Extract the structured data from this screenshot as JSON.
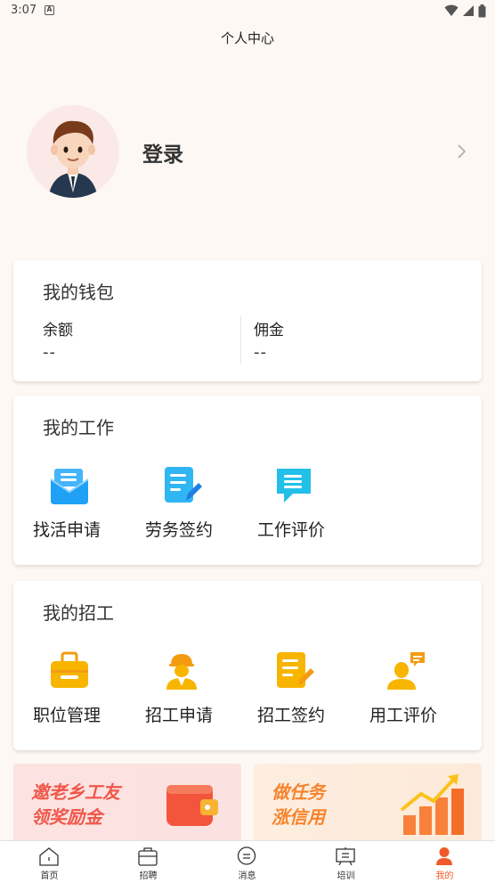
{
  "status_bar": {
    "time": "3:07"
  },
  "header": {
    "title": "个人中心"
  },
  "profile": {
    "login_label": "登录"
  },
  "wallet": {
    "title": "我的钱包",
    "balance_label": "余额",
    "balance_value": "--",
    "commission_label": "佣金",
    "commission_value": "--"
  },
  "my_work": {
    "title": "我的工作",
    "items": [
      {
        "label": "找活申请",
        "icon": "envelope-icon"
      },
      {
        "label": "劳务签约",
        "icon": "document-edit-icon"
      },
      {
        "label": "工作评价",
        "icon": "chat-bubble-icon"
      }
    ]
  },
  "my_hire": {
    "title": "我的招工",
    "items": [
      {
        "label": "职位管理",
        "icon": "briefcase-icon"
      },
      {
        "label": "招工申请",
        "icon": "worker-helmet-icon"
      },
      {
        "label": "招工签约",
        "icon": "document-edit-icon"
      },
      {
        "label": "用工评价",
        "icon": "user-comment-icon"
      }
    ]
  },
  "promos": [
    {
      "line1": "邀老乡工友",
      "line2": "领奖励金",
      "icon": "wallet-icon"
    },
    {
      "line1": "做任务",
      "line2": "涨信用",
      "icon": "growth-chart-icon"
    }
  ],
  "tabbar": {
    "items": [
      {
        "label": "首页",
        "icon": "home-icon",
        "active": false
      },
      {
        "label": "招聘",
        "icon": "recruit-icon",
        "active": false
      },
      {
        "label": "消息",
        "icon": "message-icon",
        "active": false
      },
      {
        "label": "培训",
        "icon": "training-icon",
        "active": false
      },
      {
        "label": "我的",
        "icon": "person-icon",
        "active": true
      }
    ]
  },
  "colors": {
    "page_bg": "#fdf8f4",
    "accent": "#f05a2a",
    "work_icon_blue": "#1fa2f5",
    "hire_icon_yellow": "#f7b500",
    "promo_red": "#f0574a",
    "promo_orange": "#f7842d"
  }
}
